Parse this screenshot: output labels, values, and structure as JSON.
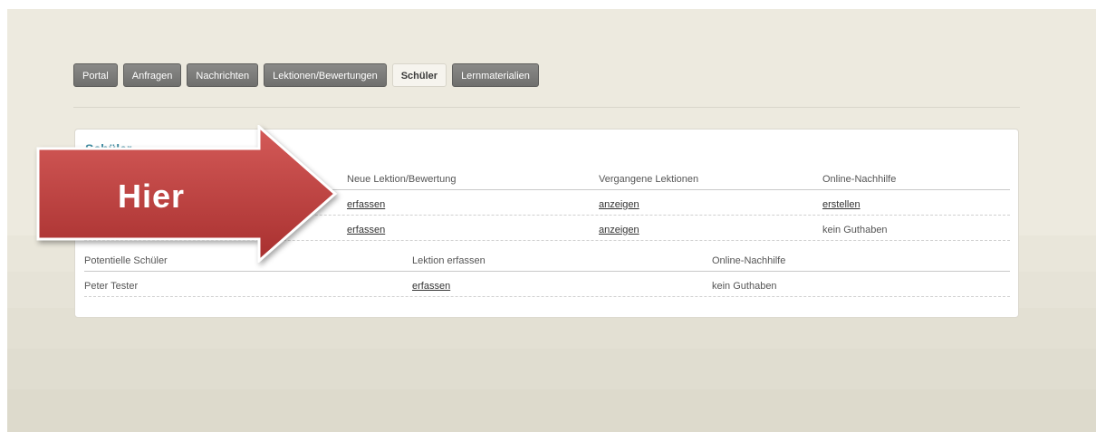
{
  "tabs": [
    {
      "label": "Portal",
      "active": false
    },
    {
      "label": "Anfragen",
      "active": false
    },
    {
      "label": "Nachrichten",
      "active": false
    },
    {
      "label": "Lektionen/Bewertungen",
      "active": false
    },
    {
      "label": "Schüler",
      "active": true
    },
    {
      "label": "Lernmaterialien",
      "active": false
    }
  ],
  "card": {
    "title": "Schüler",
    "students_table": {
      "columns": [
        "Neue Lektion/Bewertung",
        "Vergangene Lektionen",
        "Online-Nachhilfe"
      ],
      "rows": [
        {
          "new_lesson": "erfassen",
          "past_lessons": "anzeigen",
          "online": "erstellen",
          "online_is_link": true
        },
        {
          "new_lesson": "erfassen",
          "past_lessons": "anzeigen",
          "online": "kein Guthaben",
          "online_is_link": false
        }
      ]
    },
    "potential_table": {
      "columns": [
        "Potentielle Schüler",
        "Lektion erfassen",
        "Online-Nachhilfe"
      ],
      "rows": [
        {
          "name": "Peter Tester",
          "lesson": "erfassen",
          "online": "kein Guthaben"
        }
      ]
    }
  },
  "callout": {
    "label": "Hier",
    "colors": {
      "fill_top": "#d45a58",
      "fill_bottom": "#a8302f",
      "stroke": "#ffffff"
    }
  }
}
